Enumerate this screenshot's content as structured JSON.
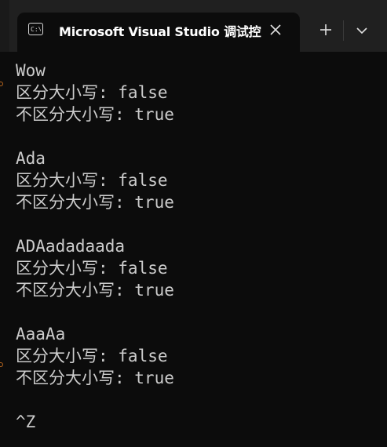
{
  "window": {
    "tab_title": "Microsoft Visual Studio 调试控"
  },
  "icons": {
    "tab_icon": "terminal-icon",
    "close": "close-icon",
    "new_tab": "plus-icon",
    "dropdown": "chevron-down-icon"
  },
  "terminal": {
    "blocks": [
      {
        "word": "Wow",
        "case_sensitive": "区分大小写: false",
        "case_insensitive": "不区分大小写: true"
      },
      {
        "word": "Ada",
        "case_sensitive": "区分大小写: false",
        "case_insensitive": "不区分大小写: true"
      },
      {
        "word": "ADAadadaada",
        "case_sensitive": "区分大小写: false",
        "case_insensitive": "不区分大小写: true"
      },
      {
        "word": "AaaAa",
        "case_sensitive": "区分大小写: false",
        "case_insensitive": "不区分大小写: true"
      }
    ],
    "eof_marker": "^Z"
  },
  "colors": {
    "background": "#0c0c0c",
    "titlebar": "#202020",
    "text": "#cccccc",
    "tab_title": "#ffffff"
  }
}
